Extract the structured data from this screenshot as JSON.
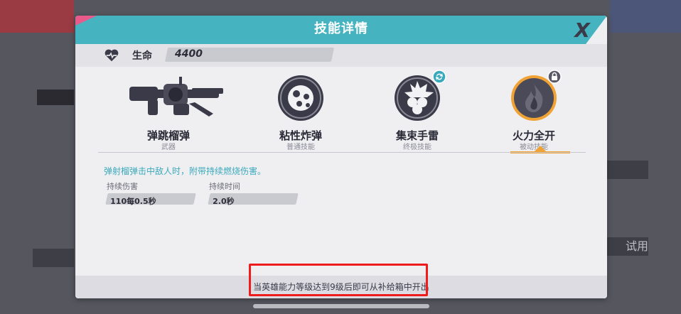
{
  "dialog": {
    "title": "技能详情",
    "close_label": "X",
    "stat": {
      "label": "生命",
      "value": "4400"
    },
    "skills": [
      {
        "name": "弹跳榴弹",
        "type": "武器"
      },
      {
        "name": "粘性炸弹",
        "type": "普通技能"
      },
      {
        "name": "集束手雷",
        "type": "终极技能"
      },
      {
        "name": "火力全开",
        "type": "被动技能"
      }
    ],
    "selected_skill_index": 3,
    "description": "弹射榴弹击中敌人时，附带持续燃烧伤害。",
    "attributes": [
      {
        "label": "持续伤害",
        "value": "110每0.5秒"
      },
      {
        "label": "持续时间",
        "value": "2.0秒"
      }
    ],
    "footer": "当英雄能力等级达到9级后即可从补给箱中开出"
  },
  "background": {
    "side_right_button": "试用"
  },
  "colors": {
    "title_bar": "#46b3c0",
    "accent_pink": "#e85a8a",
    "selected_orange": "#f0a234",
    "description_text": "#3aa9bb",
    "highlight_red": "#ee1c1c"
  },
  "icons": {
    "health": "heart-pulse-icon",
    "weapon": "grenade-launcher-icon",
    "skill_1": "sticky-bomb-icon",
    "skill_2": "cluster-grenade-icon",
    "skill_2_badge": "swap-icon",
    "skill_3": "flame-icon",
    "skill_3_badge": "lock-icon"
  }
}
